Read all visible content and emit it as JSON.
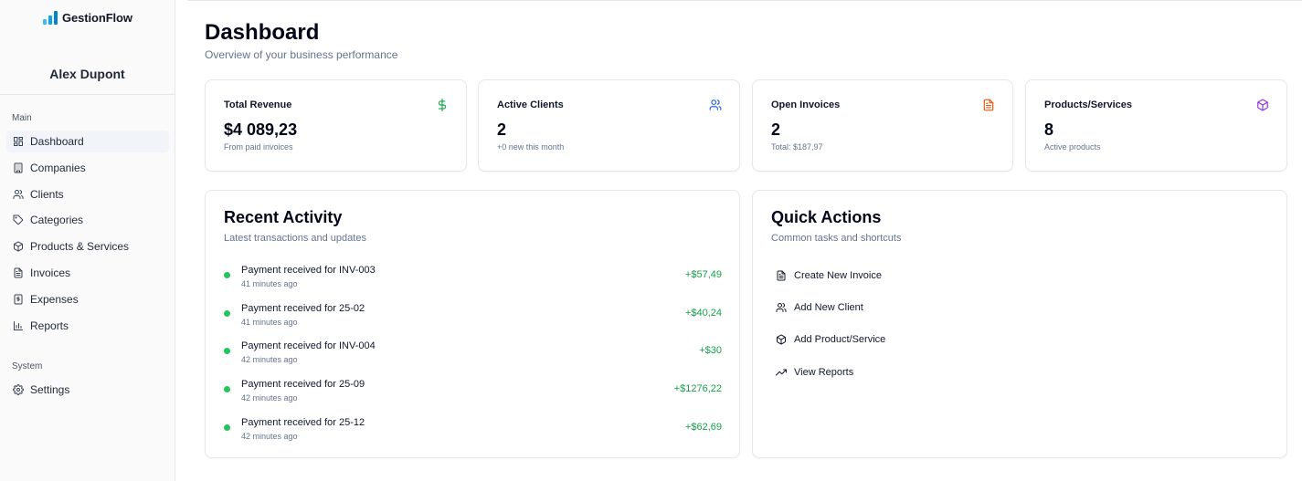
{
  "app": {
    "name": "GestionFlow",
    "user": "Alex Dupont"
  },
  "sidebar": {
    "main_label": "Main",
    "system_label": "System",
    "main_items": [
      {
        "label": "Dashboard",
        "icon": "dashboard-icon"
      },
      {
        "label": "Companies",
        "icon": "building-icon"
      },
      {
        "label": "Clients",
        "icon": "users-icon"
      },
      {
        "label": "Categories",
        "icon": "tag-icon"
      },
      {
        "label": "Products & Services",
        "icon": "package-icon"
      },
      {
        "label": "Invoices",
        "icon": "file-icon"
      },
      {
        "label": "Expenses",
        "icon": "receipt-icon"
      },
      {
        "label": "Reports",
        "icon": "bar-chart-icon"
      }
    ],
    "system_items": [
      {
        "label": "Settings",
        "icon": "gear-icon"
      }
    ]
  },
  "header": {
    "title": "Dashboard",
    "subtitle": "Overview of your business performance"
  },
  "stats": [
    {
      "title": "Total Revenue",
      "value": "$4 089,23",
      "note": "From paid invoices",
      "icon": "dollar-icon",
      "color": "#16a34a"
    },
    {
      "title": "Active Clients",
      "value": "2",
      "note": "+0 new this month",
      "icon": "users-icon",
      "color": "#2563eb"
    },
    {
      "title": "Open Invoices",
      "value": "2",
      "note": "Total: $187,97",
      "icon": "file-icon",
      "color": "#ea580c"
    },
    {
      "title": "Products/Services",
      "value": "8",
      "note": "Active products",
      "icon": "package-icon",
      "color": "#9333ea"
    }
  ],
  "activity": {
    "title": "Recent Activity",
    "subtitle": "Latest transactions and updates",
    "items": [
      {
        "title": "Payment received for INV-003",
        "time": "41 minutes ago",
        "amount": "+$57,49"
      },
      {
        "title": "Payment received for 25-02",
        "time": "41 minutes ago",
        "amount": "+$40,24"
      },
      {
        "title": "Payment received for INV-004",
        "time": "42 minutes ago",
        "amount": "+$30"
      },
      {
        "title": "Payment received for 25-09",
        "time": "42 minutes ago",
        "amount": "+$1276,22"
      },
      {
        "title": "Payment received for 25-12",
        "time": "42 minutes ago",
        "amount": "+$62,69"
      }
    ]
  },
  "quick_actions": {
    "title": "Quick Actions",
    "subtitle": "Common tasks and shortcuts",
    "items": [
      {
        "label": "Create New Invoice",
        "icon": "file-icon"
      },
      {
        "label": "Add New Client",
        "icon": "users-icon"
      },
      {
        "label": "Add Product/Service",
        "icon": "package-icon"
      },
      {
        "label": "View Reports",
        "icon": "trending-up-icon"
      }
    ]
  },
  "colors": {
    "accent_green": "#22c55e",
    "brand_blue": "#0ea5e9"
  }
}
